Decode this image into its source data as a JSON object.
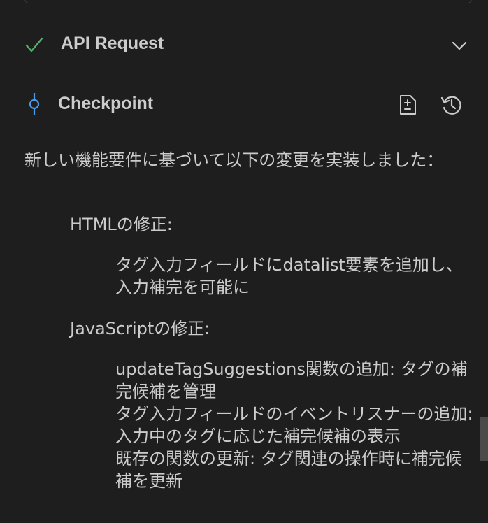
{
  "api_request": {
    "title": "API Request",
    "status_icon": "check-icon",
    "status_color": "#56b06b"
  },
  "checkpoint": {
    "title": "Checkpoint",
    "icon_color": "#4a9be8",
    "actions": [
      "compare-diff-icon",
      "restore-history-icon"
    ]
  },
  "message": {
    "intro": "新しい機能要件に基づいて以下の変更を実装しました：",
    "sections": [
      {
        "heading": "HTMLの修正:",
        "items": [
          "タグ入力フィールドにdatalist要素を追加し、入力補完を可能に"
        ]
      },
      {
        "heading": "JavaScriptの修正:",
        "items": [
          "updateTagSuggestions関数の追加: タグの補完候補を管理",
          "タグ入力フィールドのイベントリスナーの追加: 入力中のタグに応じた補完候補の表示",
          "既存の関数の更新: タグ関連の操作時に補完候補を更新"
        ]
      }
    ]
  }
}
